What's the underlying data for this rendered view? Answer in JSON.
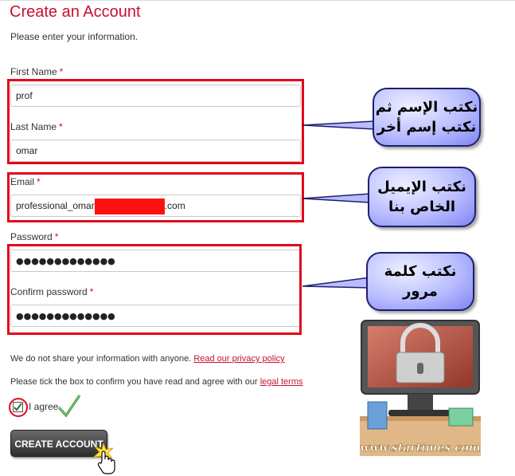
{
  "page": {
    "title": "Create an Account",
    "intro": "Please enter your information."
  },
  "form": {
    "required_mark": "*",
    "first_name": {
      "label": "First Name",
      "value": "prof"
    },
    "last_name": {
      "label": "Last Name",
      "value": "omar"
    },
    "email": {
      "label": "Email",
      "value_prefix": "professional_omar",
      "value_suffix": ".com"
    },
    "password": {
      "label": "Password",
      "value": "●●●●●●●●●●●●●"
    },
    "confirm_password": {
      "label": "Confirm password",
      "value": "●●●●●●●●●●●●●"
    },
    "privacy_text": "We do not share your information with anyone.",
    "privacy_link": "Read our privacy policy",
    "legal_text": "Please tick the box to confirm you have read and agree with our",
    "legal_link": "legal terms",
    "agree_label": "I agree",
    "agree_checked": true,
    "submit_label": "CREATE ACCOUNT"
  },
  "annotations": {
    "name_callout": [
      "نكتب الإسم ثم",
      "نكتب إسم أخر"
    ],
    "email_callout": [
      "نكتب الإيميل",
      "الخاص بنا"
    ],
    "password_callout": [
      "نكتب كلمة",
      "مرور"
    ]
  },
  "watermark": {
    "url": "www.startimes.com"
  },
  "colors": {
    "accent": "#c8102e",
    "highlight_box": "#e2061b",
    "callout": "#b9bdff",
    "button": "#3a3a3a",
    "check": "#2e8b2e"
  }
}
